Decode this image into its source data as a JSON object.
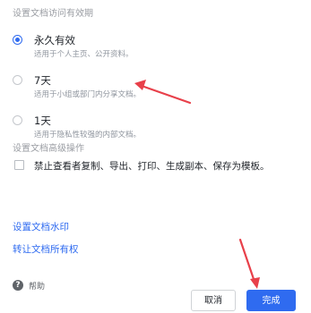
{
  "expiry": {
    "title": "设置文档访问有效期",
    "options": [
      {
        "label": "永久有效",
        "desc": "适用于个人主页、公开资料。",
        "checked": true
      },
      {
        "label": "7天",
        "desc": "适用于小组或部门内分享文档。",
        "checked": false
      },
      {
        "label": "1天",
        "desc": "适用于隐私性较强的内部文档。",
        "checked": false
      }
    ]
  },
  "advanced": {
    "title": "设置文档高级操作",
    "checkbox_label": "禁止查看者复制、导出、打印、生成副本、保存为模板。",
    "checked": false
  },
  "links": {
    "watermark": "设置文档水印",
    "transfer_owner": "转让文档所有权"
  },
  "help": {
    "icon_glyph": "?",
    "label": "帮助"
  },
  "buttons": {
    "cancel": "取消",
    "confirm": "完成"
  },
  "colors": {
    "accent": "#2f6bf0",
    "annotation_arrow": "#e8404a"
  }
}
